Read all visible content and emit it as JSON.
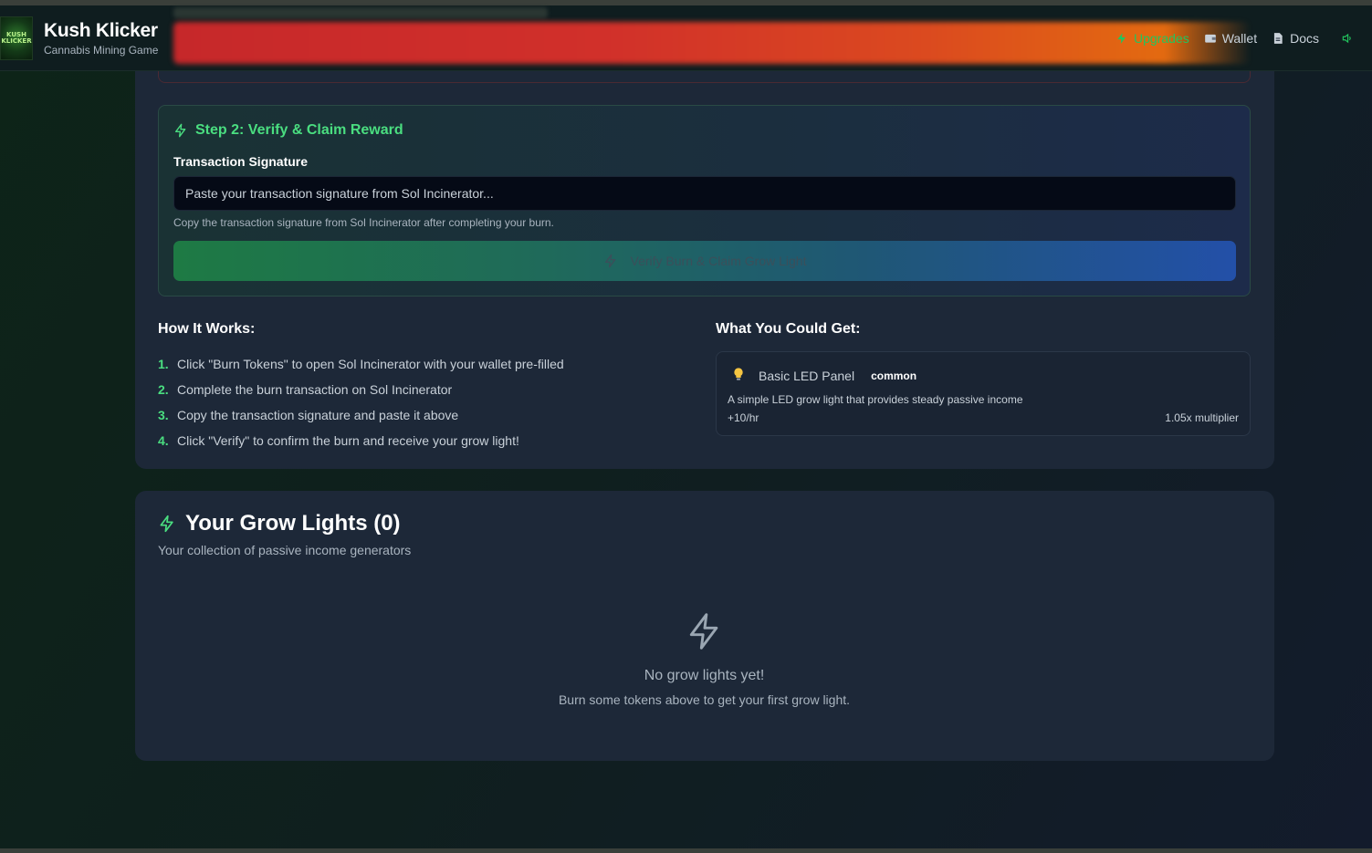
{
  "header": {
    "logo_text": "KUSH KLICKER",
    "title": "Kush Klicker",
    "subtitle": "Cannabis Mining Game",
    "nav": [
      {
        "label": "Upgrades",
        "icon": "zap-icon",
        "active": true
      },
      {
        "label": "Wallet",
        "icon": "wallet-icon",
        "active": false
      },
      {
        "label": "Docs",
        "icon": "document-icon",
        "active": false
      }
    ],
    "sound_icon": "volume-icon"
  },
  "step2": {
    "title": "Step 2: Verify & Claim Reward",
    "field_label": "Transaction Signature",
    "input_value": "",
    "input_placeholder": "Paste your transaction signature from Sol Incinerator...",
    "hint": "Copy the transaction signature from Sol Incinerator after completing your burn.",
    "button_label": "Verify Burn & Claim Grow Light"
  },
  "how": {
    "title": "How It Works:",
    "steps": [
      {
        "num": "1.",
        "text": "Click \"Burn Tokens\" to open Sol Incinerator with your wallet pre-filled"
      },
      {
        "num": "2.",
        "text": "Complete the burn transaction on Sol Incinerator"
      },
      {
        "num": "3.",
        "text": "Copy the transaction signature and paste it above"
      },
      {
        "num": "4.",
        "text": "Click \"Verify\" to confirm the burn and receive your grow light!"
      }
    ]
  },
  "could_get": {
    "title": "What You Could Get:",
    "item": {
      "icon": "lightbulb-icon",
      "name": "Basic LED Panel",
      "rarity": "common",
      "description": "A simple LED grow light that provides steady passive income",
      "rate": "+10/hr",
      "multiplier": "1.05x multiplier"
    }
  },
  "grow_lights": {
    "title": "Your Grow Lights (0)",
    "subtitle": "Your collection of passive income generators",
    "empty_title": "No grow lights yet!",
    "empty_subtitle": "Burn some tokens above to get your first grow light."
  },
  "colors": {
    "accent": "#4ade80",
    "card": "#1d2838",
    "banner_red": "#c6282a",
    "banner_orange": "#e36a10"
  }
}
